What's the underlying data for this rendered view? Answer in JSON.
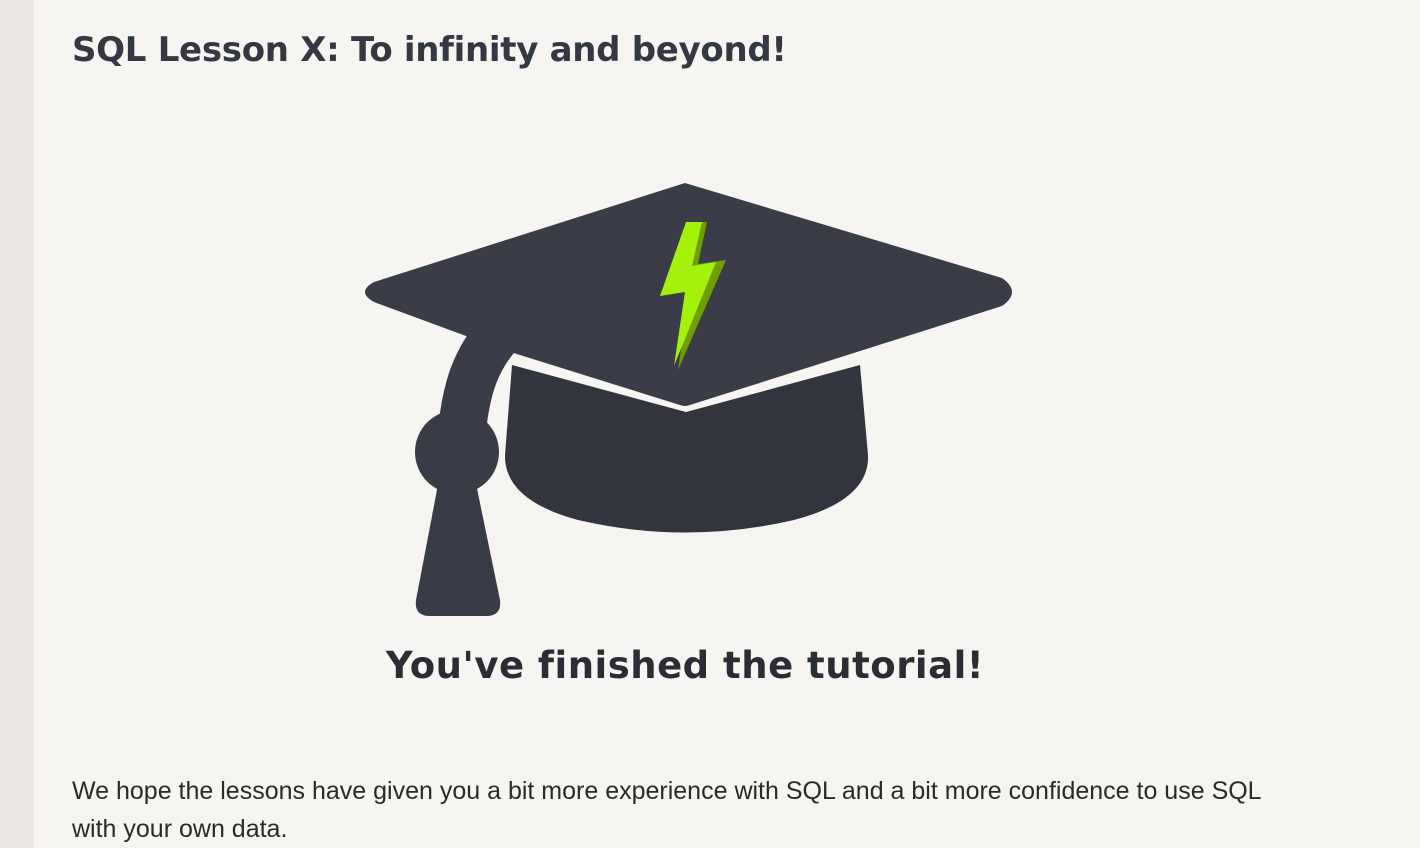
{
  "lesson": {
    "title": "SQL Lesson X: To infinity and beyond!"
  },
  "completion": {
    "heading": "You've finished the tutorial!",
    "graphic_icon": "graduation-cap-icon",
    "accent_color": "#a4f20c"
  },
  "body": {
    "paragraph": "We hope the lessons have given you a bit more experience with SQL and a bit more confidence to use SQL with your own data."
  },
  "colors": {
    "background": "#f6f5f1",
    "cap": "#393c47",
    "text": "#2a2a2a"
  }
}
